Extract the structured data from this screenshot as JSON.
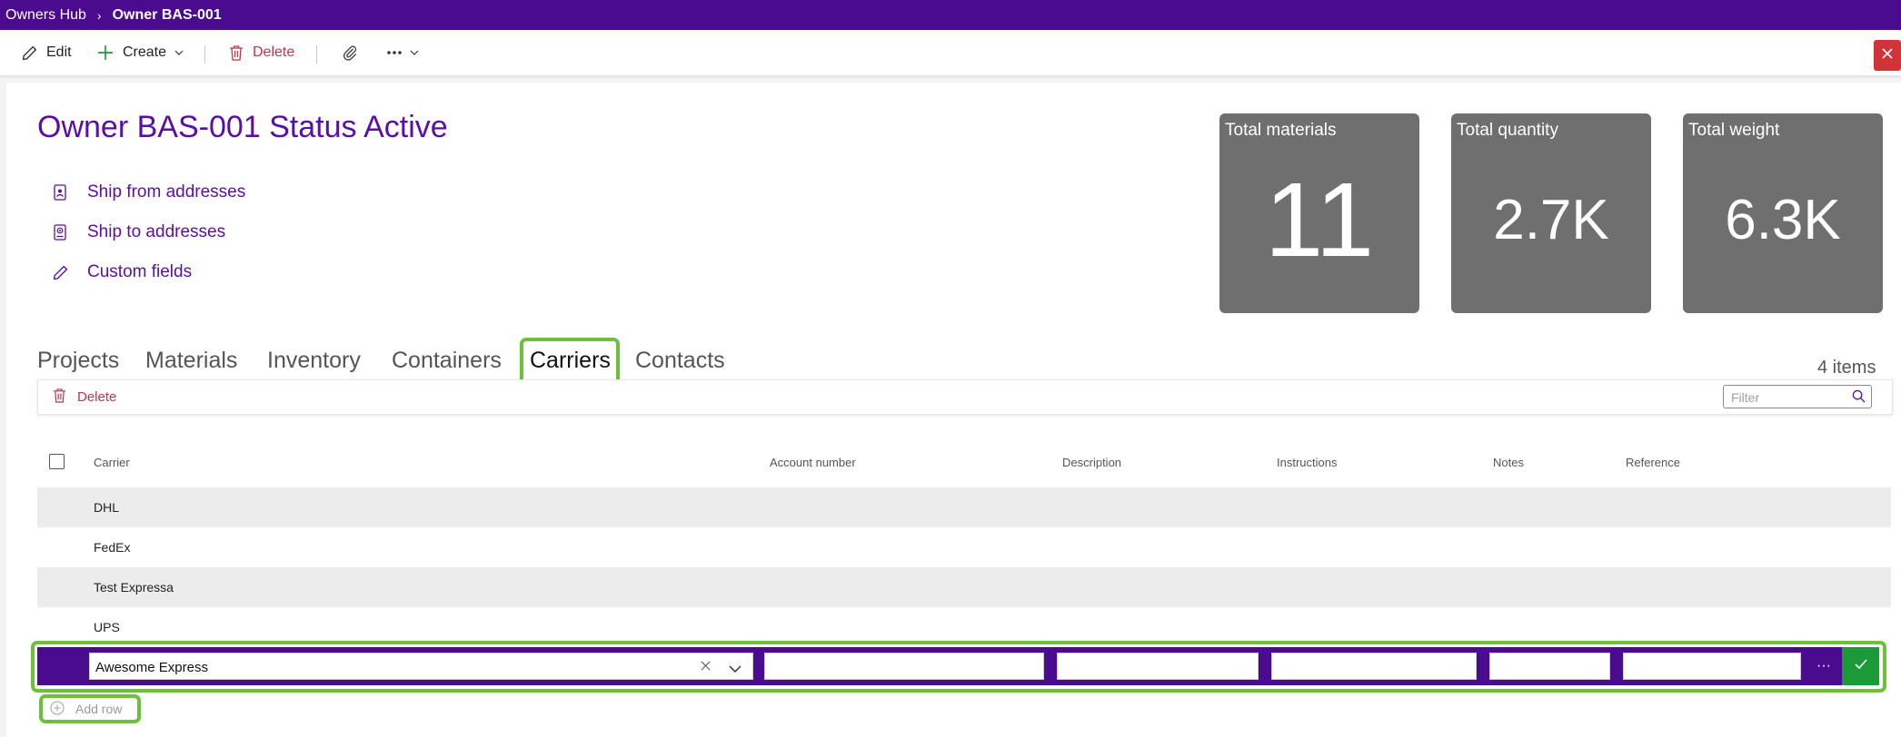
{
  "breadcrumb": {
    "root": "Owners Hub",
    "separator": "›",
    "current": "Owner BAS-001"
  },
  "commands": {
    "edit": "Edit",
    "create": "Create",
    "delete": "Delete",
    "icons": [
      "pencil-icon",
      "plus-icon",
      "chevron-down-icon",
      "trash-icon",
      "paperclip-icon",
      "more-icon",
      "close-icon"
    ]
  },
  "owner": {
    "title": "Owner BAS-001 Status Active",
    "links": [
      {
        "label": "Ship from addresses",
        "icon": "contact-card-icon"
      },
      {
        "label": "Ship to addresses",
        "icon": "address-book-icon"
      },
      {
        "label": "Custom fields",
        "icon": "pencil-icon"
      }
    ]
  },
  "stats": [
    {
      "title": "Total materials",
      "value": "11"
    },
    {
      "title": "Total quantity",
      "value": "2.7K"
    },
    {
      "title": "Total weight",
      "value": "6.3K"
    }
  ],
  "tabs": [
    "Projects",
    "Materials",
    "Inventory",
    "Containers",
    "Carriers",
    "Contacts"
  ],
  "active_tab": "Carriers",
  "item_count": "4 items",
  "grid": {
    "delete_label": "Delete",
    "filter_placeholder": "Filter",
    "columns": [
      "Carrier",
      "Account number",
      "Description",
      "Instructions",
      "Notes",
      "Reference"
    ],
    "rows": [
      "DHL",
      "FedEx",
      "Test Expressa",
      "UPS"
    ],
    "editing": {
      "carrier": "Awesome Express",
      "account_number": "",
      "description": "",
      "instructions": "",
      "notes": "",
      "reference": ""
    },
    "more_label": "···",
    "add_row_label": "Add row"
  },
  "colors": {
    "header_purple": "#4b0b8f",
    "accent_purple": "#5a0ea8",
    "tile_gray": "#6f6f6f",
    "confirm_green": "#1c9a3a",
    "delete_red": "#c4314b",
    "highlight_green": "#6dc03a"
  }
}
